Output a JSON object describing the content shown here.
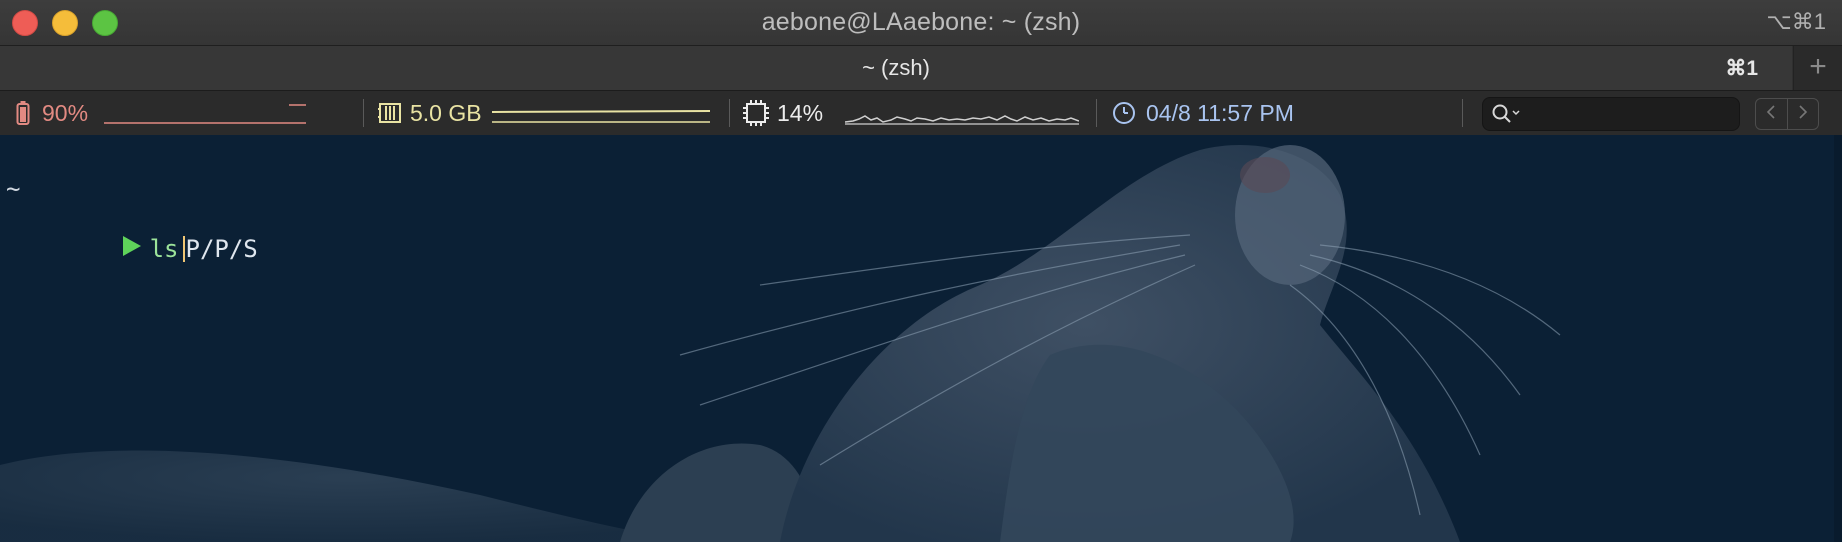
{
  "window": {
    "title": "aebone@LAaebone: ~ (zsh)",
    "title_shortcut": "⌥⌘1"
  },
  "tabs": [
    {
      "label": "~ (zsh)",
      "shortcut": "⌘1",
      "active": true
    }
  ],
  "tab_add_icon": "plus-icon",
  "status_bar": {
    "battery": {
      "icon": "battery-icon",
      "value": "90%",
      "color": "#e28a82"
    },
    "memory": {
      "icon": "memory-icon",
      "value": "5.0 GB",
      "color": "#e9e3a3"
    },
    "cpu": {
      "icon": "cpu-icon",
      "value": "14%",
      "color": "#ececec"
    },
    "clock": {
      "icon": "clock-icon",
      "value": "04/8 11:57 PM",
      "color": "#a9c4f0"
    },
    "search": {
      "icon": "search-icon",
      "placeholder": ""
    },
    "nav": {
      "prev_icon": "chevron-left-icon",
      "next_icon": "chevron-right-icon"
    }
  },
  "terminal": {
    "cwd": "~",
    "prompt_icon": "prompt-arrow-icon",
    "command": "ls",
    "args": "P/P/S",
    "background": "cat-photo",
    "colors": {
      "prompt": "#5fd35a",
      "command": "#9ce39a",
      "cursor": "#f0c674"
    }
  }
}
